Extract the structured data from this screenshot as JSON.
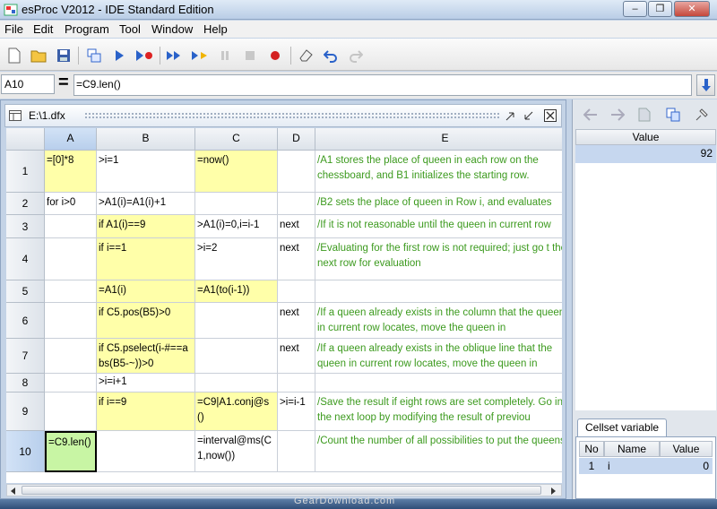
{
  "window": {
    "title": "esProc V2012 - IDE Standard Edition"
  },
  "menu": [
    "File",
    "Edit",
    "Program",
    "Tool",
    "Window",
    "Help"
  ],
  "formula_bar": {
    "cell_ref": "A10",
    "equals": "=",
    "formula": "=C9.len()"
  },
  "document": {
    "name": "E:\\1.dfx"
  },
  "grid": {
    "columns": [
      "A",
      "B",
      "C",
      "D",
      "E"
    ],
    "rows": [
      {
        "num": "1",
        "A": "=[0]*8",
        "B": ">i=1",
        "C": "=now()",
        "D": "",
        "E": "/A1 stores the place of queen in each row on the chessboard, and B1 initializes the starting row."
      },
      {
        "num": "2",
        "A": "for i>0",
        "B": ">A1(i)=A1(i)+1",
        "C": "",
        "D": "",
        "E": "/B2 sets the place of queen in Row i, and evaluates"
      },
      {
        "num": "3",
        "A": "",
        "B": "if A1(i)==9",
        "C": ">A1(i)=0,i=i-1",
        "D": "next",
        "E": "/If it is not reasonable until the queen in current row"
      },
      {
        "num": "4",
        "A": "",
        "B": "if i==1",
        "C": ">i=2",
        "D": "next",
        "E": "/Evaluating for the first row is not required; just go t the next row for evaluation"
      },
      {
        "num": "5",
        "A": "",
        "B": "=A1(i)",
        "C": "=A1(to(i-1))",
        "D": "",
        "E": ""
      },
      {
        "num": "6",
        "A": "",
        "B": "if C5.pos(B5)>0",
        "C": "",
        "D": "next",
        "E": "/If a queen already exists in the column that the queen in current row locates, move the queen in"
      },
      {
        "num": "7",
        "A": "",
        "B": "if C5.pselect(i-#==abs(B5-~))>0",
        "C": "",
        "D": "next",
        "E": "/If a queen already exists in the oblique line that the queen in current row locates, move the queen in"
      },
      {
        "num": "8",
        "A": "",
        "B": ">i=i+1",
        "C": "",
        "D": "",
        "E": ""
      },
      {
        "num": "9",
        "A": "",
        "B": "if i==9",
        "C": "=C9|A1.conj@s()",
        "D": ">i=i-1",
        "E": "/Save the result if eight rows are set completely. Go into the next loop by modifying the result of previou"
      },
      {
        "num": "10",
        "A": "=C9.len()",
        "B": "",
        "C": "=interval@ms(C1,now())",
        "D": "",
        "E": "/Count the number of all possibilities to put the queens."
      }
    ]
  },
  "value_panel": {
    "header": "Value",
    "value": "92"
  },
  "cellset_variable": {
    "tab": "Cellset variable",
    "headers": [
      "No",
      "Name",
      "Value"
    ],
    "rows": [
      {
        "no": "1",
        "name": "i",
        "value": "0"
      }
    ]
  },
  "watermark": "GearDownload.com",
  "colors": {
    "formula_cell": "#ffffa9",
    "selected_cell": "#c8f5a4",
    "comment_text": "#3c9a1e"
  }
}
